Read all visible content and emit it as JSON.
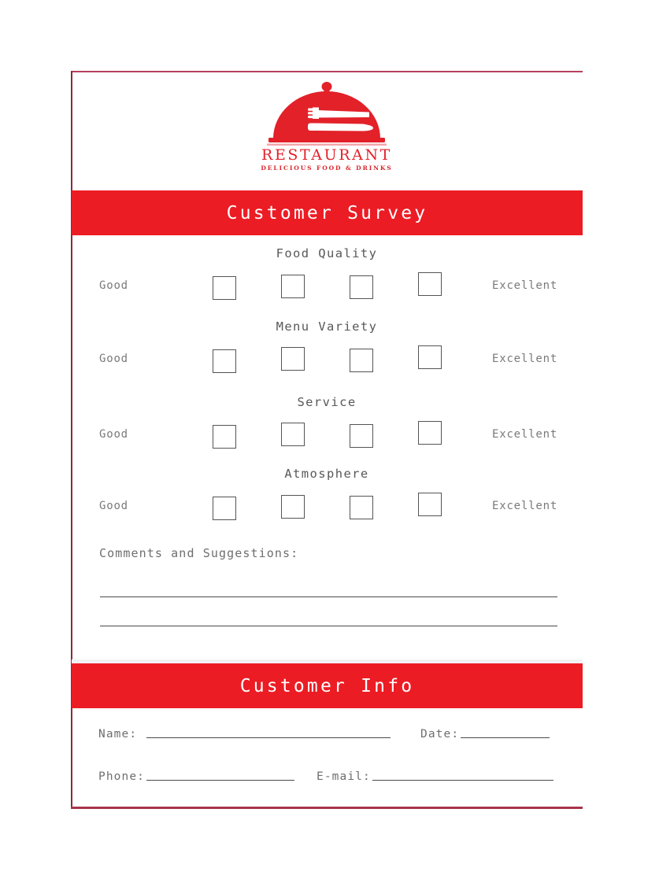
{
  "document": {
    "type": "restaurant-customer-survey-form",
    "page_background": "#ffffff",
    "sheet_border_color": "#a8334d",
    "banner_color": "#ec1c24",
    "banner_text_color": "#ffffff",
    "ink_color": "#58585a"
  },
  "logo": {
    "icon": "cloche-dome-with-fork-and-knife-icon",
    "wordmark": "RESTAURANT",
    "tagline": "DELICIOUS FOOD & DRINKS",
    "color": "#e32129"
  },
  "banners": {
    "survey": "Customer Survey",
    "info": "Customer Info"
  },
  "survey": {
    "scale_low_label": "Good",
    "scale_high_label": "Excellent",
    "checkbox_count": 4,
    "groups": [
      {
        "title": "Food Quality",
        "low": "Good",
        "high": "Excellent",
        "checked": [
          false,
          false,
          false,
          false
        ]
      },
      {
        "title": "Menu Variety",
        "low": "Good",
        "high": "Excellent",
        "checked": [
          false,
          false,
          false,
          false
        ]
      },
      {
        "title": "Service",
        "low": "Good",
        "high": "Excellent",
        "checked": [
          false,
          false,
          false,
          false
        ]
      },
      {
        "title": "Atmosphere",
        "low": "Good",
        "high": "Excellent",
        "checked": [
          false,
          false,
          false,
          false
        ]
      }
    ]
  },
  "comments": {
    "label": "Comments and Suggestions:",
    "line_count": 2,
    "lines": [
      "",
      ""
    ]
  },
  "customer_info": {
    "fields": [
      {
        "label": "Name:",
        "value": ""
      },
      {
        "label": "Date:",
        "value": ""
      },
      {
        "label": "Phone:",
        "value": ""
      },
      {
        "label": "E-mail:",
        "value": ""
      }
    ]
  }
}
